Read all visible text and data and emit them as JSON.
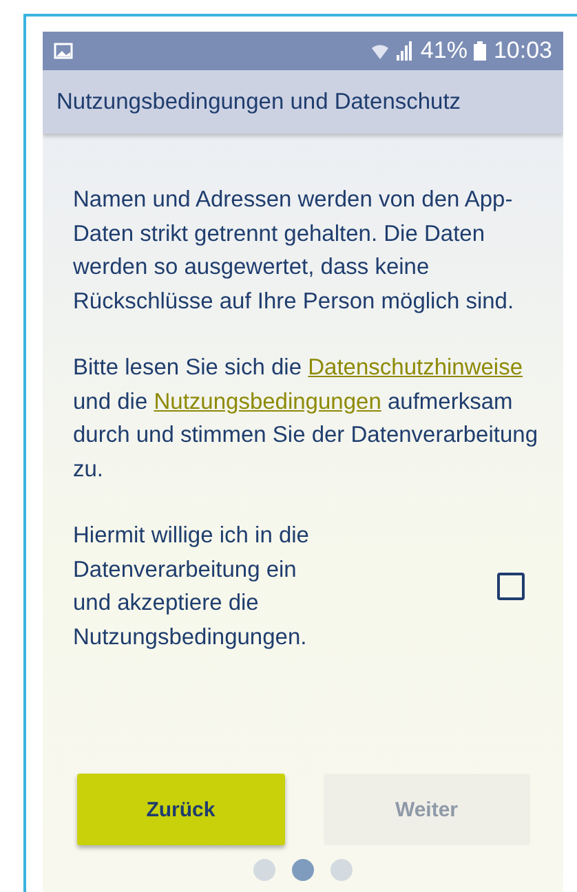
{
  "status_bar": {
    "battery": "41%",
    "time": "10:03"
  },
  "app_bar": {
    "title": "Nutzungsbedingungen und Datenschutz"
  },
  "intro": "Namen und Adressen werden von den App-Daten strikt getrennt gehalten. Die Daten werden so ausgewertet, dass keine Rückschlüsse auf Ihre Person möglich sind.",
  "notice": [
    {
      "kind": "text",
      "text": "Bitte lesen Sie sich die"
    },
    {
      "kind": "link",
      "text": "Datenschutzhinweise"
    },
    {
      "kind": "text",
      "text": "und die"
    },
    {
      "kind": "link",
      "text": "Nutzungsbedingungen"
    },
    {
      "kind": "text",
      "text": "aufmerksam durch und stimmen Sie der Datenverarbeitung zu."
    }
  ],
  "consent": {
    "label": "Hiermit willige ich in die Datenverarbeitung ein und akzeptiere die Nutzungsbedingungen.",
    "checked": false
  },
  "buttons": [
    {
      "label": "Zurück",
      "disabled": false
    },
    {
      "label": "Weiter",
      "disabled": true
    }
  ],
  "pager": [
    {
      "selected": false
    },
    {
      "selected": true
    },
    {
      "selected": false
    }
  ]
}
